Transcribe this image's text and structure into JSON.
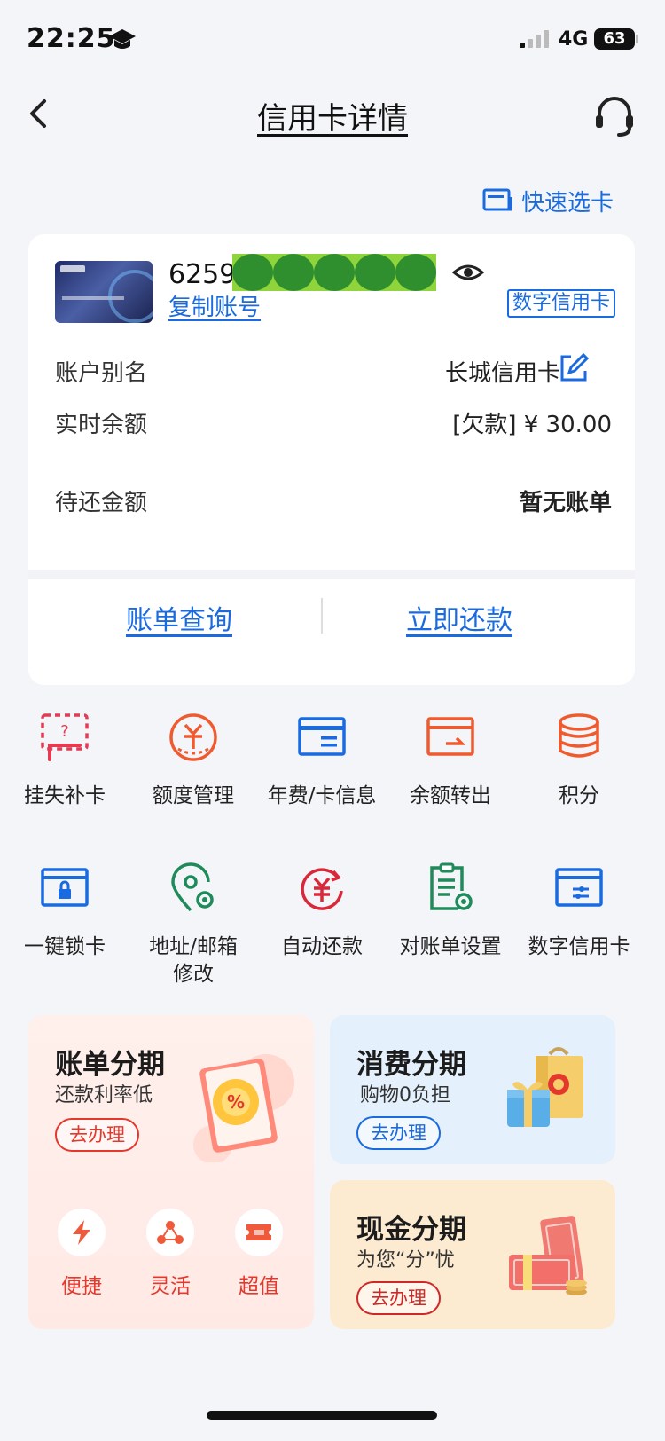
{
  "status_bar": {
    "time": "22:25",
    "network": "4G",
    "battery": "63"
  },
  "nav": {
    "title": "信用卡详情"
  },
  "quick_select": {
    "label": "快速选卡"
  },
  "card": {
    "number_prefix": "6259",
    "copy_label": "复制账号",
    "digital_tag": "数字信用卡",
    "rows": [
      {
        "label": "账户别名",
        "value": "长城信用卡"
      },
      {
        "label": "实时余额",
        "value": "[欠款] ¥ 30.00"
      },
      {
        "label": "待还金额",
        "value": "暂无账单"
      }
    ],
    "bill_query": "账单查询",
    "repay_now": "立即还款"
  },
  "grid": [
    {
      "label": "挂失补卡",
      "icon": "lost-card-icon"
    },
    {
      "label": "额度管理",
      "icon": "credit-limit-icon"
    },
    {
      "label": "年费/卡信息",
      "icon": "card-info-icon"
    },
    {
      "label": "余额转出",
      "icon": "balance-transfer-icon"
    },
    {
      "label": "积分",
      "icon": "points-icon"
    },
    {
      "label": "一键锁卡",
      "icon": "lock-card-icon"
    },
    {
      "label": "地址/邮箱\n修改",
      "icon": "address-icon"
    },
    {
      "label": "自动还款",
      "icon": "auto-repay-icon"
    },
    {
      "label": "对账单设置",
      "icon": "statement-settings-icon"
    },
    {
      "label": "数字信用卡",
      "icon": "digital-card-icon"
    }
  ],
  "promos": {
    "bill_installment": {
      "title": "账单分期",
      "subtitle": "还款利率低",
      "button": "去办理",
      "features": [
        "便捷",
        "灵活",
        "超值"
      ]
    },
    "consumer_installment": {
      "title": "消费分期",
      "subtitle": "购物0负担",
      "button": "去办理"
    },
    "cash_installment": {
      "title": "现金分期",
      "subtitle": "为您“分”忧",
      "button": "去办理"
    }
  },
  "colors": {
    "accent_blue": "#1a6be0",
    "accent_red": "#e5382c",
    "green_icon": "#1f8a5a"
  }
}
